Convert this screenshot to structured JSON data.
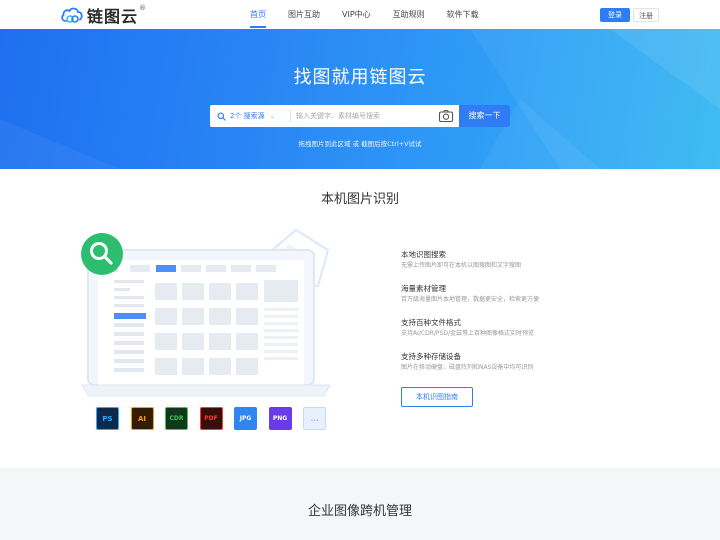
{
  "header": {
    "logo_text": "链图云",
    "logo_reg": "®",
    "nav": [
      "首页",
      "图片互助",
      "VIP中心",
      "互助规则",
      "软件下载"
    ],
    "active_nav": "首页",
    "login_label": "登录",
    "register_label": "注册"
  },
  "hero": {
    "title": "找图就用链图云",
    "search": {
      "scope_label": "2个 搜索源",
      "placeholder": "输入关键字、素材编号搜索",
      "button_label": "搜索一下",
      "camera_icon": "camera-icon",
      "scope_icon": "search-icon"
    },
    "tip": "拖拽图片到此区域 或 截图后按Ctrl+V试试"
  },
  "local_recognition": {
    "title": "本机图片识别",
    "features": [
      {
        "title": "本地识图搜索",
        "desc": "无需上传图片即可在本机以图搜图和文字搜图"
      },
      {
        "title": "海量素材管理",
        "desc": "百万级海量图片本地管理，数据更安全，检索更方便"
      },
      {
        "title": "支持百种文件格式",
        "desc": "支持AI/CDR/PSD/金兹等上百种图像格式实时预览"
      },
      {
        "title": "支持多种存储设备",
        "desc": "图片在移动硬盘、磁盘阵列和NAS设备中均可识别"
      }
    ],
    "guide_button": "本机识图指南",
    "formats": [
      {
        "label": "PS",
        "bg": "#0e2a46",
        "fg": "#31a8ff"
      },
      {
        "label": "AI",
        "bg": "#331c00",
        "fg": "#ff9a00"
      },
      {
        "label": "CDR",
        "bg": "#10381c",
        "fg": "#46c25a"
      },
      {
        "label": "PDF",
        "bg": "#3a0d0d",
        "fg": "#ff3b30"
      },
      {
        "label": "JPG",
        "bg": "#2f86f0",
        "fg": "#ffffff"
      },
      {
        "label": "PNG",
        "bg": "#6a3be8",
        "fg": "#ffffff"
      },
      {
        "label": "...",
        "bg": "#e8effd",
        "fg": "#9db3e0"
      }
    ],
    "search_badge_icon": "magnifier-icon",
    "colors": {
      "accent": "#2f7cf6",
      "badge": "#2dbd6e"
    }
  },
  "enterprise": {
    "title": "企业图像跨机管理"
  }
}
